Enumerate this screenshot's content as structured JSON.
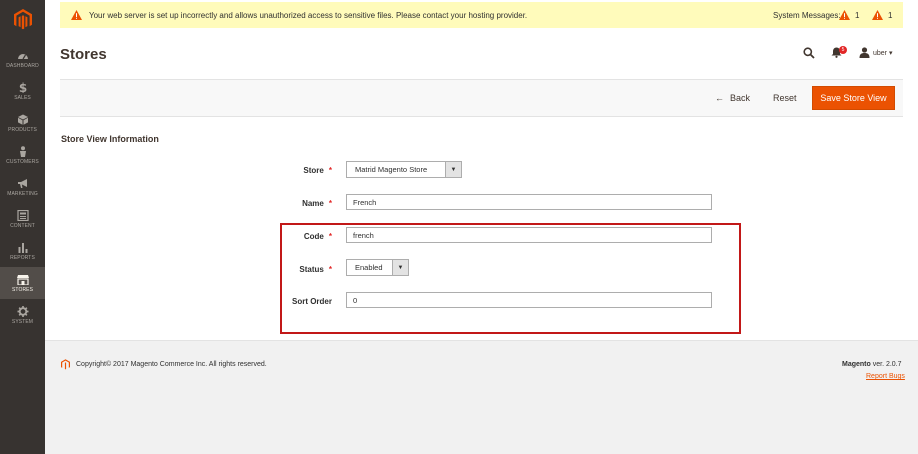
{
  "sidebar": {
    "logo": "magento-logo",
    "items": [
      {
        "label": "DASHBOARD",
        "icon": "dashboard-icon"
      },
      {
        "label": "SALES",
        "icon": "dollar-icon"
      },
      {
        "label": "PRODUCTS",
        "icon": "cube-icon"
      },
      {
        "label": "CUSTOMERS",
        "icon": "person-icon"
      },
      {
        "label": "MARKETING",
        "icon": "megaphone-icon"
      },
      {
        "label": "CONTENT",
        "icon": "content-icon"
      },
      {
        "label": "REPORTS",
        "icon": "bar-chart-icon"
      },
      {
        "label": "STORES",
        "icon": "storefront-icon"
      },
      {
        "label": "SYSTEM",
        "icon": "gear-icon"
      }
    ],
    "active_index": 7
  },
  "system_bar": {
    "message": "Your web server is set up incorrectly and allows unauthorized access to sensitive files. Please contact your hosting provider.",
    "label": "System Messages:",
    "count_critical": "1",
    "count_major": "1"
  },
  "header": {
    "title": "Stores",
    "notification_count": "5",
    "username": "uber"
  },
  "actions": {
    "back_label": "Back",
    "reset_label": "Reset",
    "save_label": "Save Store View"
  },
  "form": {
    "section_title": "Store View Information",
    "store": {
      "label": "Store",
      "value": "Matrid Magento Store"
    },
    "name": {
      "label": "Name",
      "value": "French"
    },
    "code": {
      "label": "Code",
      "value": "french"
    },
    "status": {
      "label": "Status",
      "value": "Enabled"
    },
    "sort_order": {
      "label": "Sort Order",
      "value": "0"
    }
  },
  "footer": {
    "copyright": "Copyright© 2017 Magento Commerce Inc. All rights reserved.",
    "brand": "Magento",
    "version": " ver. 2.0.7",
    "report_bugs": "Report Bugs"
  },
  "colors": {
    "accent": "#eb5202",
    "sidebar": "#373330",
    "highlight": "#c21818",
    "notice": "#fffbbb"
  }
}
